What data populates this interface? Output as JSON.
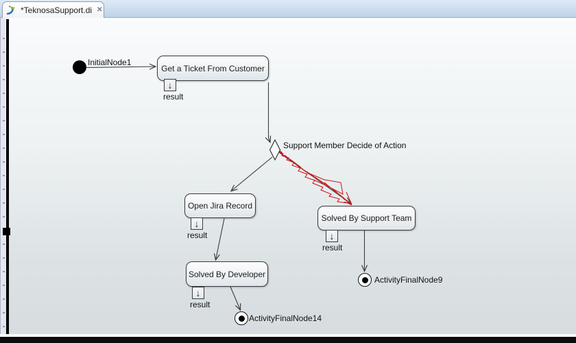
{
  "editor": {
    "tab": {
      "title": "*TeknosaSupport.di",
      "close_icon": "✕",
      "app_icon": "papyrus-swoosh"
    }
  },
  "diagram": {
    "initial_node": {
      "name": "InitialNode1"
    },
    "decision_node": {
      "name": "Support Member Decide of Action"
    },
    "actions": [
      {
        "name": "Get a Ticket From Customer",
        "pin": "result"
      },
      {
        "name": "Open Jira Record",
        "pin": "result"
      },
      {
        "name": "Solved By Support Team",
        "pin": "result"
      },
      {
        "name": "Solved By Developer",
        "pin": "result"
      }
    ],
    "final_nodes": [
      {
        "name": "ActivityFinalNode9"
      },
      {
        "name": "ActivityFinalNode14"
      }
    ],
    "icons": {
      "pin_arrow": "↓"
    },
    "colors": {
      "edge": "#3c3c3c",
      "sketch_red": "#cc1111",
      "node_border": "#3a3a3a",
      "tab_icon_blue": "#2e77b4",
      "tab_icon_green": "#8cc31e"
    }
  }
}
